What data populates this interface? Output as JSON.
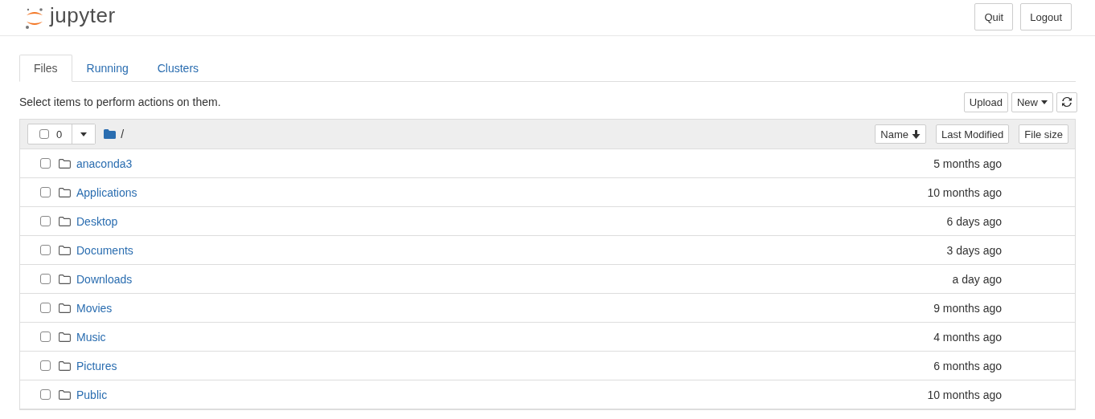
{
  "header": {
    "logo_text": "jupyter",
    "buttons": [
      "Quit",
      "Logout"
    ]
  },
  "tabs": [
    {
      "label": "Files",
      "selected": true
    },
    {
      "label": "Running",
      "selected": false
    },
    {
      "label": "Clusters",
      "selected": false
    }
  ],
  "toolbar": {
    "hint": "Select items to perform actions on them.",
    "upload": "Upload",
    "new": "New"
  },
  "list_header": {
    "selected_count": "0",
    "select_all_checked": false,
    "path": "/",
    "sort_buttons": [
      "Name",
      "Last Modified",
      "File size"
    ]
  },
  "rows": [
    {
      "name": "anaconda3",
      "modified": "5 months ago",
      "checked": false
    },
    {
      "name": "Applications",
      "modified": "10 months ago",
      "checked": false
    },
    {
      "name": "Desktop",
      "modified": "6 days ago",
      "checked": false
    },
    {
      "name": "Documents",
      "modified": "3 days ago",
      "checked": false
    },
    {
      "name": "Downloads",
      "modified": "a day ago",
      "checked": false
    },
    {
      "name": "Movies",
      "modified": "9 months ago",
      "checked": false
    },
    {
      "name": "Music",
      "modified": "4 months ago",
      "checked": false
    },
    {
      "name": "Pictures",
      "modified": "6 months ago",
      "checked": false
    },
    {
      "name": "Public",
      "modified": "10 months ago",
      "checked": false
    }
  ]
}
